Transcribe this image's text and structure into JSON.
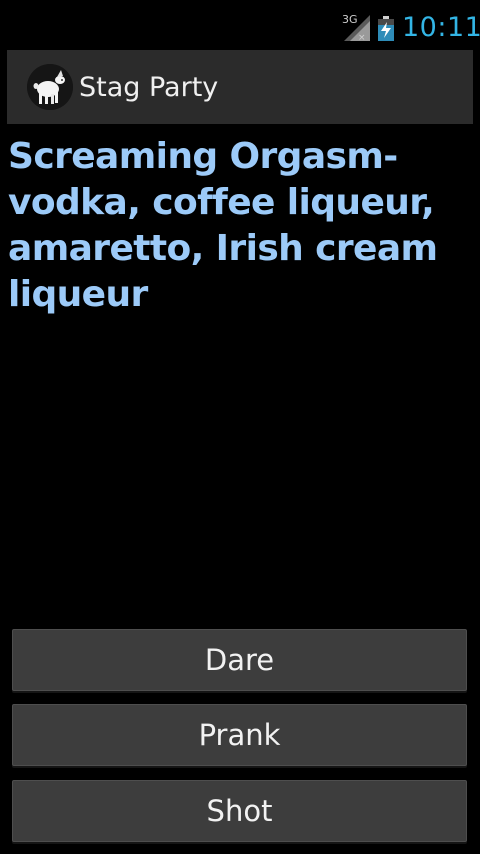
{
  "status_bar": {
    "network": "3G",
    "time": "10:11",
    "icons": [
      "signal-3g-icon",
      "battery-charging-icon"
    ],
    "time_color": "#33b5e5"
  },
  "action_bar": {
    "title": "Stag Party",
    "icon": "stag-app-icon"
  },
  "content": {
    "text": "Screaming Orgasm- vodka, coffee liqueur, amaretto, Irish cream liqueur",
    "text_color": "#9ccaf8"
  },
  "buttons": {
    "dare": "Dare",
    "prank": "Prank",
    "shot": "Shot"
  }
}
